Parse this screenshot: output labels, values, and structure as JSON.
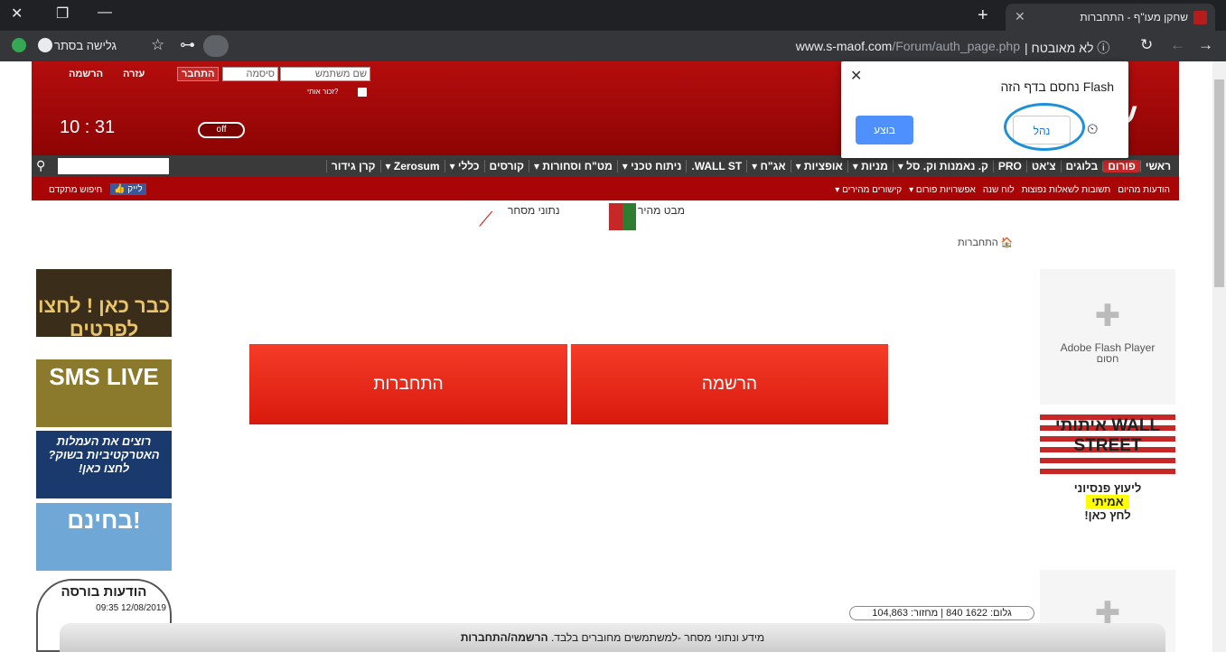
{
  "browser": {
    "tab_title": "שחקן מעו\"ף - התחברות",
    "url_host": "www.s-maof.com",
    "url_path": "/Forum/auth_page.php",
    "security_label": "לא מאובטח",
    "incognito_label": "גלישה בסתר"
  },
  "header": {
    "username_placeholder": "שם משתמש",
    "password_placeholder": "סיסמה",
    "login_button": "התחבר",
    "help_link": "עזרה",
    "register_link": "הרשמה",
    "remember_label": "זכור אותי?",
    "clock": "10 : 31",
    "off_label": "off"
  },
  "nav": {
    "items": [
      "ראשי",
      "פורום",
      "בלוגים",
      "צ'אט",
      "PRO",
      "ק. נאמנות וק. סל ▾",
      "מניות ▾",
      "אופציות ▾",
      "אג\"ח ▾",
      "WALL ST.",
      "ניתוח טכני ▾",
      "מט\"ח וסחורות ▾",
      "קורסים",
      "כללי ▾",
      "Zerosum ▾",
      "קרן גידור"
    ]
  },
  "subnav": {
    "items": [
      "הודעות מהיום",
      "תשובות לשאלות נפוצות",
      "לוח שנה",
      "אפשרויות פורום ▾",
      "קישורים מהירים ▾"
    ],
    "like_label": "לייק",
    "advanced_search": "חיפוש מתקדם"
  },
  "tools": {
    "quick_view": "מבט מהיר",
    "trade_data": "נתוני מסחר"
  },
  "breadcrumb": "התחברות",
  "main": {
    "register_button": "הרשמה",
    "login_button": "התחברות"
  },
  "left_ads": [
    "כבר כאן ! לחצו לפרטים",
    "SMS LIVE",
    "רוצים את העמלות האטרקטיביות בשוק? לחצו כאן!",
    "בחינם!"
  ],
  "right_ads": {
    "flash_blocked": "Adobe Flash Player",
    "flash_blocked_sub": "חסום",
    "wallstreet": "איתותי WALL STREET",
    "pension": "ליעוץ פנסיוני",
    "pension_real": "אמיתי",
    "pension_click": "לחץ כאן!"
  },
  "news": {
    "title": "הודעות בורסה",
    "date": "09:35 12/08/2019"
  },
  "ticker": "גלום: 1622 840 | מחזור: 104,863",
  "footer": {
    "text": "מידע ונתוני מסחר -למשתמשים מחוברים בלבד.",
    "bold": "הרשמה/התחברות"
  },
  "flash_popup": {
    "title": "Flash נחסם בדף הזה",
    "manage": "נהל",
    "done": "בוצע"
  }
}
